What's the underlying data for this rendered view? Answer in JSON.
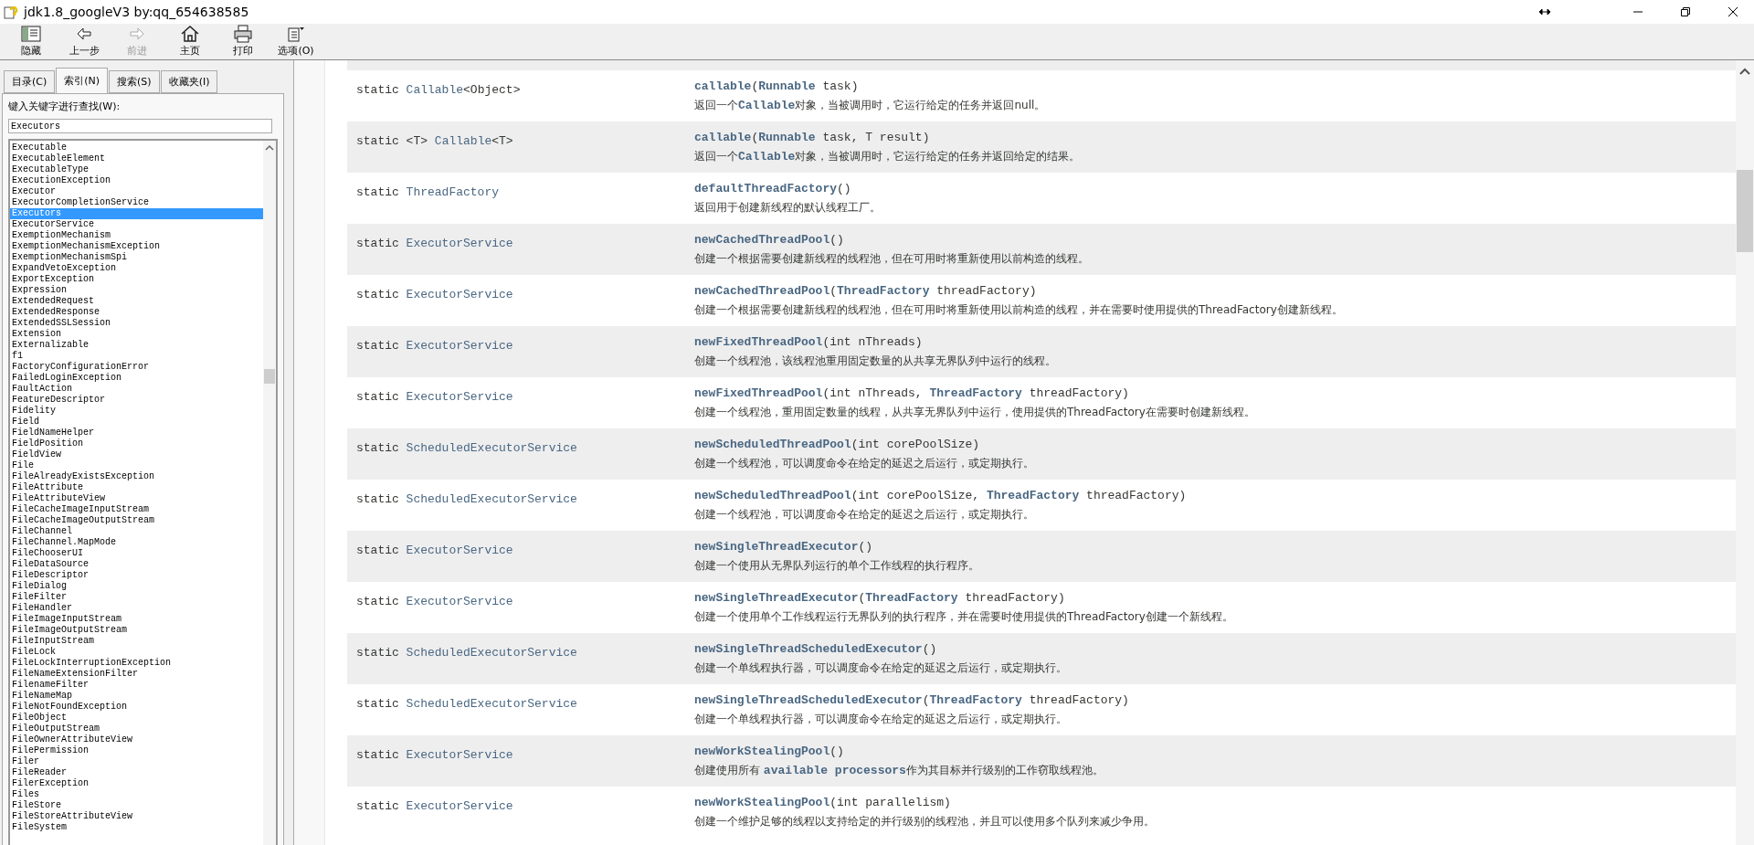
{
  "window": {
    "title": "jdk1.8_googleV3 by:qq_654638585"
  },
  "toolbar": [
    {
      "kind": "hide",
      "label": "隐藏",
      "disabled": false
    },
    {
      "kind": "back",
      "label": "上一步",
      "disabled": false
    },
    {
      "kind": "forward",
      "label": "前进",
      "disabled": true
    },
    {
      "kind": "home",
      "label": "主页",
      "disabled": false
    },
    {
      "kind": "print",
      "label": "打印",
      "disabled": false
    },
    {
      "kind": "options",
      "label": "选项(O)",
      "disabled": false
    }
  ],
  "tabs": [
    {
      "label": "目录(C)",
      "selected": false
    },
    {
      "label": "索引(N)",
      "selected": true
    },
    {
      "label": "搜索(S)",
      "selected": false
    },
    {
      "label": "收藏夹(I)",
      "selected": false
    }
  ],
  "index": {
    "prompt": "键入关键字进行查找(W):",
    "search": {
      "value": "Executors"
    },
    "items": [
      {
        "label": "Executable",
        "selected": false
      },
      {
        "label": "ExecutableElement",
        "selected": false
      },
      {
        "label": "ExecutableType",
        "selected": false
      },
      {
        "label": "ExecutionException",
        "selected": false
      },
      {
        "label": "Executor",
        "selected": false
      },
      {
        "label": "ExecutorCompletionService",
        "selected": false
      },
      {
        "label": "Executors",
        "selected": true
      },
      {
        "label": "ExecutorService",
        "selected": false
      },
      {
        "label": "ExemptionMechanism",
        "selected": false
      },
      {
        "label": "ExemptionMechanismException",
        "selected": false
      },
      {
        "label": "ExemptionMechanismSpi",
        "selected": false
      },
      {
        "label": "ExpandVetoException",
        "selected": false
      },
      {
        "label": "ExportException",
        "selected": false
      },
      {
        "label": "Expression",
        "selected": false
      },
      {
        "label": "ExtendedRequest",
        "selected": false
      },
      {
        "label": "ExtendedResponse",
        "selected": false
      },
      {
        "label": "ExtendedSSLSession",
        "selected": false
      },
      {
        "label": "Extension",
        "selected": false
      },
      {
        "label": "Externalizable",
        "selected": false
      },
      {
        "label": "f1",
        "selected": false
      },
      {
        "label": "FactoryConfigurationError",
        "selected": false
      },
      {
        "label": "FailedLoginException",
        "selected": false
      },
      {
        "label": "FaultAction",
        "selected": false
      },
      {
        "label": "FeatureDescriptor",
        "selected": false
      },
      {
        "label": "Fidelity",
        "selected": false
      },
      {
        "label": "Field",
        "selected": false
      },
      {
        "label": "FieldNameHelper",
        "selected": false
      },
      {
        "label": "FieldPosition",
        "selected": false
      },
      {
        "label": "FieldView",
        "selected": false
      },
      {
        "label": "File",
        "selected": false
      },
      {
        "label": "FileAlreadyExistsException",
        "selected": false
      },
      {
        "label": "FileAttribute",
        "selected": false
      },
      {
        "label": "FileAttributeView",
        "selected": false
      },
      {
        "label": "FileCacheImageInputStream",
        "selected": false
      },
      {
        "label": "FileCacheImageOutputStream",
        "selected": false
      },
      {
        "label": "FileChannel",
        "selected": false
      },
      {
        "label": "FileChannel.MapMode",
        "selected": false
      },
      {
        "label": "FileChooserUI",
        "selected": false
      },
      {
        "label": "FileDataSource",
        "selected": false
      },
      {
        "label": "FileDescriptor",
        "selected": false
      },
      {
        "label": "FileDialog",
        "selected": false
      },
      {
        "label": "FileFilter",
        "selected": false
      },
      {
        "label": "FileHandler",
        "selected": false
      },
      {
        "label": "FileImageInputStream",
        "selected": false
      },
      {
        "label": "FileImageOutputStream",
        "selected": false
      },
      {
        "label": "FileInputStream",
        "selected": false
      },
      {
        "label": "FileLock",
        "selected": false
      },
      {
        "label": "FileLockInterruptionException",
        "selected": false
      },
      {
        "label": "FileNameExtensionFilter",
        "selected": false
      },
      {
        "label": "FilenameFilter",
        "selected": false
      },
      {
        "label": "FileNameMap",
        "selected": false
      },
      {
        "label": "FileNotFoundException",
        "selected": false
      },
      {
        "label": "FileObject",
        "selected": false
      },
      {
        "label": "FileOutputStream",
        "selected": false
      },
      {
        "label": "FileOwnerAttributeView",
        "selected": false
      },
      {
        "label": "FilePermission",
        "selected": false
      },
      {
        "label": "Filer",
        "selected": false
      },
      {
        "label": "FileReader",
        "selected": false
      },
      {
        "label": "FilerException",
        "selected": false
      },
      {
        "label": "Files",
        "selected": false
      },
      {
        "label": "FileStore",
        "selected": false
      },
      {
        "label": "FileStoreAttributeView",
        "selected": false
      },
      {
        "label": "FileSystem",
        "selected": false
      }
    ]
  },
  "methods": [
    {
      "modifier": "static **Callable**<Object>",
      "method": "**callable**(**Runnable** task)",
      "description": "返回一个**Callable**对象，当被调用时，它运行给定的任务并返回null。"
    },
    {
      "modifier": "static <T> **Callable**<T>",
      "method": "**callable**(**Runnable** task, T result)",
      "description": "返回一个**Callable**对象，当被调用时，它运行给定的任务并返回给定的结果。"
    },
    {
      "modifier": "static **ThreadFactory**",
      "method": "**defaultThreadFactory**()",
      "description": "返回用于创建新线程的默认线程工厂。"
    },
    {
      "modifier": "static **ExecutorService**",
      "method": "**newCachedThreadPool**()",
      "description": "创建一个根据需要创建新线程的线程池，但在可用时将重新使用以前构造的线程。"
    },
    {
      "modifier": "static **ExecutorService**",
      "method": "**newCachedThreadPool**(**ThreadFactory** threadFactory)",
      "description": "创建一个根据需要创建新线程的线程池，但在可用时将重新使用以前构造的线程，并在需要时使用提供的ThreadFactory创建新线程。"
    },
    {
      "modifier": "static **ExecutorService**",
      "method": "**newFixedThreadPool**(int nThreads)",
      "description": "创建一个线程池，该线程池重用固定数量的从共享无界队列中运行的线程。"
    },
    {
      "modifier": "static **ExecutorService**",
      "method": "**newFixedThreadPool**(int nThreads, **ThreadFactory** threadFactory)",
      "description": "创建一个线程池，重用固定数量的线程，从共享无界队列中运行，使用提供的ThreadFactory在需要时创建新线程。"
    },
    {
      "modifier": "static **ScheduledExecutorService**",
      "method": "**newScheduledThreadPool**(int corePoolSize)",
      "description": "创建一个线程池，可以调度命令在给定的延迟之后运行，或定期执行。"
    },
    {
      "modifier": "static **ScheduledExecutorService**",
      "method": "**newScheduledThreadPool**(int corePoolSize, **ThreadFactory** threadFactory)",
      "description": "创建一个线程池，可以调度命令在给定的延迟之后运行，或定期执行。"
    },
    {
      "modifier": "static **ExecutorService**",
      "method": "**newSingleThreadExecutor**()",
      "description": "创建一个使用从无界队列运行的单个工作线程的执行程序。"
    },
    {
      "modifier": "static **ExecutorService**",
      "method": "**newSingleThreadExecutor**(**ThreadFactory** threadFactory)",
      "description": "创建一个使用单个工作线程运行无界队列的执行程序，并在需要时使用提供的ThreadFactory创建一个新线程。"
    },
    {
      "modifier": "static **ScheduledExecutorService**",
      "method": "**newSingleThreadScheduledExecutor**()",
      "description": "创建一个单线程执行器，可以调度命令在给定的延迟之后运行，或定期执行。"
    },
    {
      "modifier": "static **ScheduledExecutorService**",
      "method": "**newSingleThreadScheduledExecutor**(**ThreadFactory** threadFactory)",
      "description": "创建一个单线程执行器，可以调度命令在给定的延迟之后运行，或定期执行。"
    },
    {
      "modifier": "static **ExecutorService**",
      "method": "**newWorkStealingPool**()",
      "description": "创建使用所有 **available processors**作为其目标并行级别的工作窃取线程池。"
    },
    {
      "modifier": "static **ExecutorService**",
      "method": "**newWorkStealingPool**(int parallelism)",
      "description": "创建一个维护足够的线程以支持给定的并行级别的线程池，并且可以使用多个队列来减少争用。"
    }
  ]
}
